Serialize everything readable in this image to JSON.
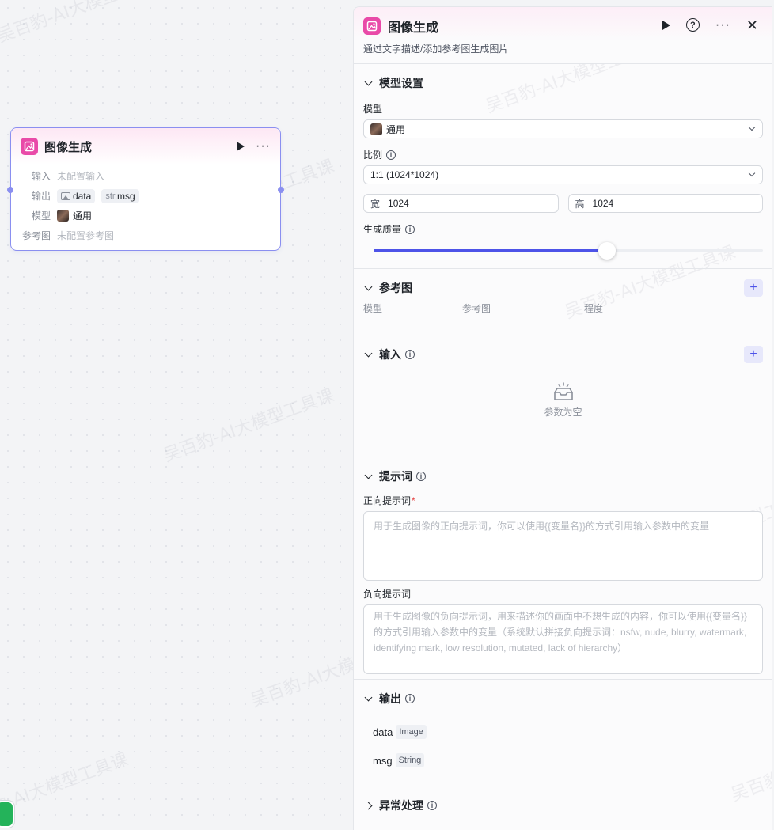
{
  "watermark": "吴百豹-AI大模型工具课",
  "node": {
    "title": "图像生成",
    "rows": {
      "input_label": "输入",
      "input_value": "未配置输入",
      "output_label": "输出",
      "output_var1": "data",
      "output_var2_type": "str.",
      "output_var2": "msg",
      "model_label": "模型",
      "model_value": "通用",
      "ref_label": "参考图",
      "ref_value": "未配置参考图"
    }
  },
  "panel": {
    "title": "图像生成",
    "description": "通过文字描述/添加参考图生成图片",
    "model_section": {
      "title": "模型设置",
      "model_label": "模型",
      "model_value": "通用",
      "ratio_label": "比例",
      "ratio_value": "1:1 (1024*1024)",
      "width_key": "宽",
      "width_value": "1024",
      "height_key": "高",
      "height_value": "1024",
      "quality_label": "生成质量",
      "quality_fraction": 0.6
    },
    "ref_section": {
      "title": "参考图",
      "col1": "模型",
      "col2": "参考图",
      "col3": "程度"
    },
    "input_section": {
      "title": "输入",
      "empty_text": "参数为空"
    },
    "prompt_section": {
      "title": "提示词",
      "positive_label": "正向提示词",
      "positive_placeholder": "用于生成图像的正向提示词，你可以使用{{变量名}}的方式引用输入参数中的变量",
      "negative_label": "负向提示词",
      "negative_placeholder": "用于生成图像的负向提示词，用来描述你的画面中不想生成的内容，你可以使用{{变量名}}的方式引用输入参数中的变量（系统默认拼接负向提示词：nsfw, nude, blurry, watermark, identifying mark, low resolution, mutated, lack of hierarchy）"
    },
    "output_section": {
      "title": "输出",
      "items": [
        {
          "name": "data",
          "type": "Image"
        },
        {
          "name": "msg",
          "type": "String"
        }
      ]
    },
    "error_section": {
      "title": "异常处理"
    }
  },
  "colors": {
    "accent": "#4d53e8",
    "brand_icon": "#e94aa8",
    "node_border": "#8a8ff0"
  },
  "icons": [
    "image-gen-icon",
    "play-icon",
    "more-icon",
    "help-icon",
    "close-icon",
    "info-icon",
    "plus-icon",
    "chevron-down-icon",
    "empty-box-icon"
  ]
}
